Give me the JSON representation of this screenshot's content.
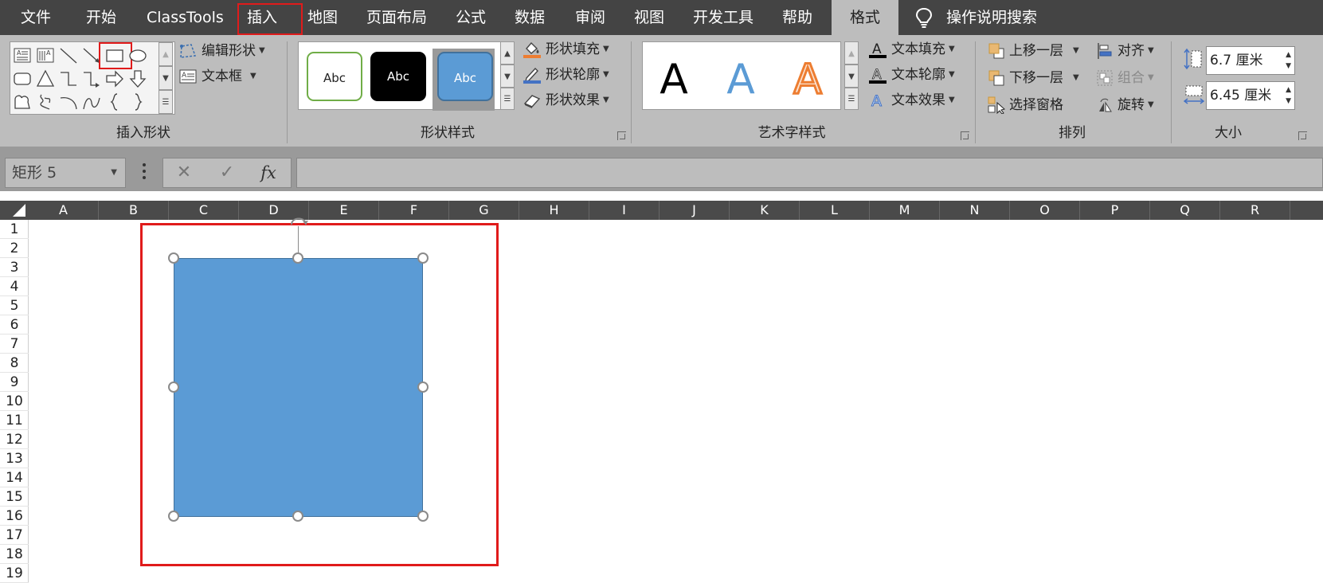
{
  "menu": {
    "items": [
      "文件",
      "开始",
      "ClassTools",
      "插入",
      "地图",
      "页面布局",
      "公式",
      "数据",
      "审阅",
      "视图",
      "开发工具",
      "帮助",
      "格式"
    ],
    "active": "格式",
    "highlighted": "插入",
    "search_label": "操作说明搜索"
  },
  "ribbon": {
    "insert_shapes": {
      "label": "插入形状",
      "edit_shape": "编辑形状",
      "text_box": "文本框",
      "highlighted_shape": "rectangle"
    },
    "shape_styles": {
      "label": "形状样式",
      "thumbs": [
        "Abc",
        "Abc",
        "Abc"
      ],
      "fill": "形状填充",
      "outline": "形状轮廓",
      "effects": "形状效果"
    },
    "wordart_styles": {
      "label": "艺术字样式",
      "letters": [
        "A",
        "A",
        "A"
      ],
      "text_fill": "文本填充",
      "text_outline": "文本轮廓",
      "text_effects": "文本效果"
    },
    "arrange": {
      "label": "排列",
      "bring_forward": "上移一层",
      "send_backward": "下移一层",
      "selection_pane": "选择窗格",
      "align": "对齐",
      "group": "组合",
      "rotate": "旋转"
    },
    "size": {
      "label": "大小",
      "height": "6.7 厘米",
      "width": "6.45 厘米"
    }
  },
  "formula_bar": {
    "name_box": "矩形 5",
    "fx": "fx",
    "formula": ""
  },
  "sheet": {
    "columns": [
      "A",
      "B",
      "C",
      "D",
      "E",
      "F",
      "G",
      "H",
      "I",
      "J",
      "K",
      "L",
      "M",
      "N",
      "O",
      "P",
      "Q",
      "R"
    ],
    "rows": [
      "1",
      "2",
      "3",
      "4",
      "5",
      "6",
      "7",
      "8",
      "9",
      "10",
      "11",
      "12",
      "13",
      "14",
      "15",
      "16",
      "17",
      "18",
      "19"
    ]
  },
  "colors": {
    "menu_bg": "#444444",
    "ribbon_bg": "#bdbdbd",
    "shape_fill": "#5b9bd5",
    "highlight": "#e01b1b"
  }
}
